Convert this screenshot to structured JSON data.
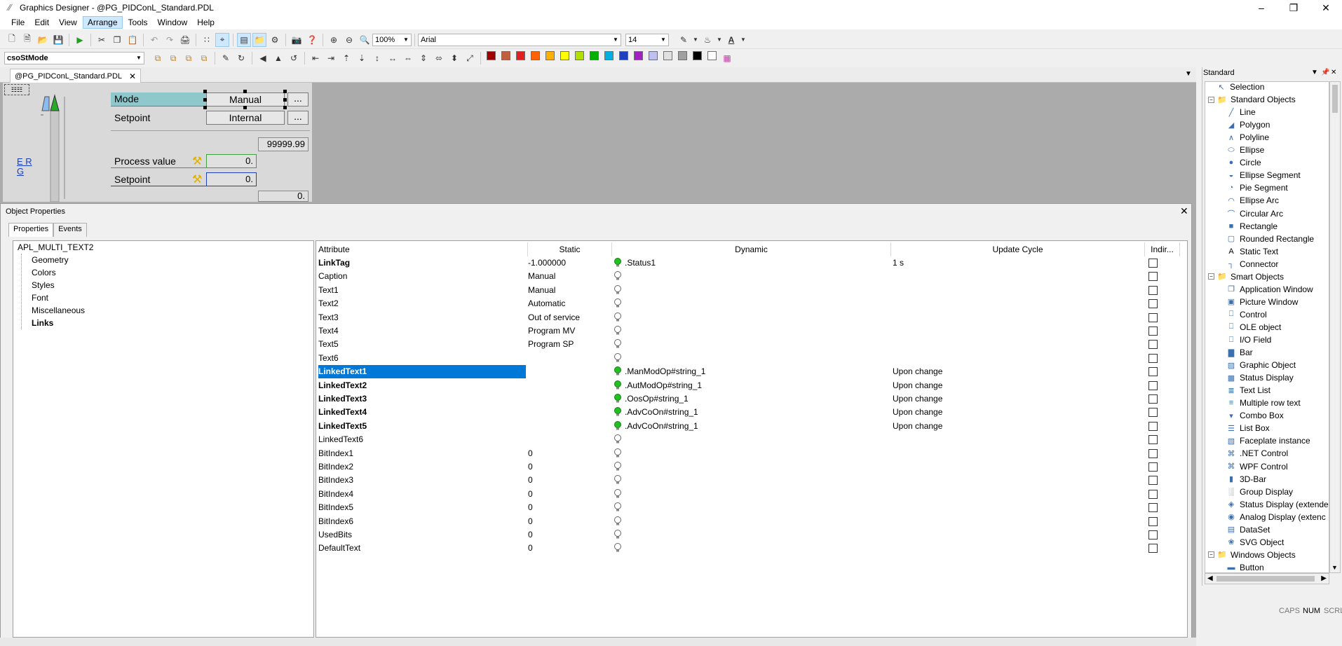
{
  "window": {
    "title": "Graphics Designer - @PG_PIDConL_Standard.PDL"
  },
  "menu": [
    "File",
    "Edit",
    "View",
    "Arrange",
    "Tools",
    "Window",
    "Help"
  ],
  "menu_active": "Arrange",
  "toolbar": {
    "zoom": "100%",
    "font_name": "Arial",
    "font_size": "14",
    "object_combo": "csoStMode"
  },
  "palette": [
    "#a00000",
    "#c06040",
    "#e02020",
    "#ff6000",
    "#ffb000",
    "#ffff00",
    "#b0e000",
    "#00b000",
    "#00b0e0",
    "#2040c0",
    "#a020c0",
    "#c0c0f0",
    "#e0e0e0",
    "#a0a0a0",
    "#000000",
    "#ffffff"
  ],
  "document": {
    "tab_label": "@PG_PIDConL_Standard.PDL"
  },
  "faceplate": {
    "mode_label": "Mode",
    "mode_value": "Manual",
    "setpoint_label": "Setpoint",
    "setpoint_value": "Internal",
    "upper_value": "99999.99",
    "process_label": "Process value",
    "process_value": "0.",
    "setpoint2_label": "Setpoint",
    "setpoint2_value": "0.",
    "lower_value": "0.",
    "side_link": "E R G",
    "more_btn": "..."
  },
  "object_properties": {
    "title": "Object Properties",
    "tabs": [
      "Properties",
      "Events"
    ],
    "tree": {
      "root": "APL_MULTI_TEXT2",
      "children": [
        "Geometry",
        "Colors",
        "Styles",
        "Font",
        "Miscellaneous",
        "Links"
      ],
      "selected": "Links"
    },
    "columns": [
      "Attribute",
      "Static",
      "Dynamic",
      "Update Cycle",
      "Indir..."
    ],
    "rows": [
      {
        "attr": "LinkTag",
        "static": "-1.000000",
        "dynamic": ".Status1",
        "cycle": "1 s",
        "bold": true,
        "green": true
      },
      {
        "attr": "Caption",
        "static": "Manual",
        "dynamic": "",
        "cycle": "",
        "bold": false,
        "green": false
      },
      {
        "attr": "Text1",
        "static": "Manual",
        "dynamic": "",
        "cycle": "",
        "bold": false,
        "green": false
      },
      {
        "attr": "Text2",
        "static": "Automatic",
        "dynamic": "",
        "cycle": "",
        "bold": false,
        "green": false
      },
      {
        "attr": "Text3",
        "static": "Out of service",
        "dynamic": "",
        "cycle": "",
        "bold": false,
        "green": false
      },
      {
        "attr": "Text4",
        "static": "Program MV",
        "dynamic": "",
        "cycle": "",
        "bold": false,
        "green": false
      },
      {
        "attr": "Text5",
        "static": "Program SP",
        "dynamic": "",
        "cycle": "",
        "bold": false,
        "green": false
      },
      {
        "attr": "Text6",
        "static": "",
        "dynamic": "",
        "cycle": "",
        "bold": false,
        "green": false
      },
      {
        "attr": "LinkedText1",
        "static": "",
        "dynamic": ".ManModOp#string_1",
        "cycle": "Upon change",
        "bold": true,
        "green": true,
        "selected": true
      },
      {
        "attr": "LinkedText2",
        "static": "",
        "dynamic": ".AutModOp#string_1",
        "cycle": "Upon change",
        "bold": true,
        "green": true
      },
      {
        "attr": "LinkedText3",
        "static": "",
        "dynamic": ".OosOp#string_1",
        "cycle": "Upon change",
        "bold": true,
        "green": true
      },
      {
        "attr": "LinkedText4",
        "static": "",
        "dynamic": ".AdvCoOn#string_1",
        "cycle": "Upon change",
        "bold": true,
        "green": true
      },
      {
        "attr": "LinkedText5",
        "static": "",
        "dynamic": ".AdvCoOn#string_1",
        "cycle": "Upon change",
        "bold": true,
        "green": true
      },
      {
        "attr": "LinkedText6",
        "static": "",
        "dynamic": "",
        "cycle": "",
        "bold": false,
        "green": false
      },
      {
        "attr": "BitIndex1",
        "static": "0",
        "dynamic": "",
        "cycle": "",
        "bold": false,
        "green": false
      },
      {
        "attr": "BitIndex2",
        "static": "0",
        "dynamic": "",
        "cycle": "",
        "bold": false,
        "green": false
      },
      {
        "attr": "BitIndex3",
        "static": "0",
        "dynamic": "",
        "cycle": "",
        "bold": false,
        "green": false
      },
      {
        "attr": "BitIndex4",
        "static": "0",
        "dynamic": "",
        "cycle": "",
        "bold": false,
        "green": false
      },
      {
        "attr": "BitIndex5",
        "static": "0",
        "dynamic": "",
        "cycle": "",
        "bold": false,
        "green": false
      },
      {
        "attr": "BitIndex6",
        "static": "0",
        "dynamic": "",
        "cycle": "",
        "bold": false,
        "green": false
      },
      {
        "attr": "UsedBits",
        "static": "0",
        "dynamic": "",
        "cycle": "",
        "bold": false,
        "green": false
      },
      {
        "attr": "DefaultText",
        "static": "0",
        "dynamic": "",
        "cycle": "",
        "bold": false,
        "green": false
      }
    ]
  },
  "standard_panel": {
    "title": "Standard",
    "items": [
      {
        "label": "Selection",
        "level": 1,
        "icon": "cursor-icon"
      },
      {
        "label": "Standard Objects",
        "level": 0,
        "icon": "folder-icon",
        "expander": "-"
      },
      {
        "label": "Line",
        "level": 2,
        "icon": "line-icon"
      },
      {
        "label": "Polygon",
        "level": 2,
        "icon": "polygon-icon"
      },
      {
        "label": "Polyline",
        "level": 2,
        "icon": "polyline-icon"
      },
      {
        "label": "Ellipse",
        "level": 2,
        "icon": "ellipse-icon"
      },
      {
        "label": "Circle",
        "level": 2,
        "icon": "circle-icon"
      },
      {
        "label": "Ellipse Segment",
        "level": 2,
        "icon": "ellipse-segment-icon"
      },
      {
        "label": "Pie Segment",
        "level": 2,
        "icon": "pie-segment-icon"
      },
      {
        "label": "Ellipse Arc",
        "level": 2,
        "icon": "ellipse-arc-icon"
      },
      {
        "label": "Circular Arc",
        "level": 2,
        "icon": "circular-arc-icon"
      },
      {
        "label": "Rectangle",
        "level": 2,
        "icon": "rectangle-icon"
      },
      {
        "label": "Rounded Rectangle",
        "level": 2,
        "icon": "rounded-rectangle-icon"
      },
      {
        "label": "Static Text",
        "level": 2,
        "icon": "static-text-icon"
      },
      {
        "label": "Connector",
        "level": 2,
        "icon": "connector-icon"
      },
      {
        "label": "Smart Objects",
        "level": 0,
        "icon": "folder-icon",
        "expander": "-"
      },
      {
        "label": "Application Window",
        "level": 2,
        "icon": "application-window-icon"
      },
      {
        "label": "Picture Window",
        "level": 2,
        "icon": "picture-window-icon"
      },
      {
        "label": "Control",
        "level": 2,
        "icon": "control-icon"
      },
      {
        "label": "OLE object",
        "level": 2,
        "icon": "ole-object-icon"
      },
      {
        "label": "I/O Field",
        "level": 2,
        "icon": "io-field-icon"
      },
      {
        "label": "Bar",
        "level": 2,
        "icon": "bar-icon"
      },
      {
        "label": "Graphic Object",
        "level": 2,
        "icon": "graphic-object-icon"
      },
      {
        "label": "Status Display",
        "level": 2,
        "icon": "status-display-icon"
      },
      {
        "label": "Text List",
        "level": 2,
        "icon": "text-list-icon"
      },
      {
        "label": "Multiple row text",
        "level": 2,
        "icon": "multiple-row-text-icon"
      },
      {
        "label": "Combo Box",
        "level": 2,
        "icon": "combo-box-icon"
      },
      {
        "label": "List Box",
        "level": 2,
        "icon": "list-box-icon"
      },
      {
        "label": "Faceplate instance",
        "level": 2,
        "icon": "faceplate-instance-icon"
      },
      {
        "label": ".NET Control",
        "level": 2,
        "icon": "net-control-icon"
      },
      {
        "label": "WPF Control",
        "level": 2,
        "icon": "wpf-control-icon"
      },
      {
        "label": "3D-Bar",
        "level": 2,
        "icon": "3d-bar-icon"
      },
      {
        "label": "Group Display",
        "level": 2,
        "icon": "group-display-icon"
      },
      {
        "label": "Status Display (extende",
        "level": 2,
        "icon": "status-display-ext-icon"
      },
      {
        "label": "Analog Display (extenc",
        "level": 2,
        "icon": "analog-display-ext-icon"
      },
      {
        "label": "DataSet",
        "level": 2,
        "icon": "dataset-icon"
      },
      {
        "label": "SVG Object",
        "level": 2,
        "icon": "svg-object-icon"
      },
      {
        "label": "Windows Objects",
        "level": 0,
        "icon": "folder-icon",
        "expander": "-"
      },
      {
        "label": "Button",
        "level": 2,
        "icon": "button-icon"
      }
    ]
  },
  "statusbar": {
    "caps": "CAPS",
    "num": "NUM",
    "scrl": "SCRL"
  }
}
